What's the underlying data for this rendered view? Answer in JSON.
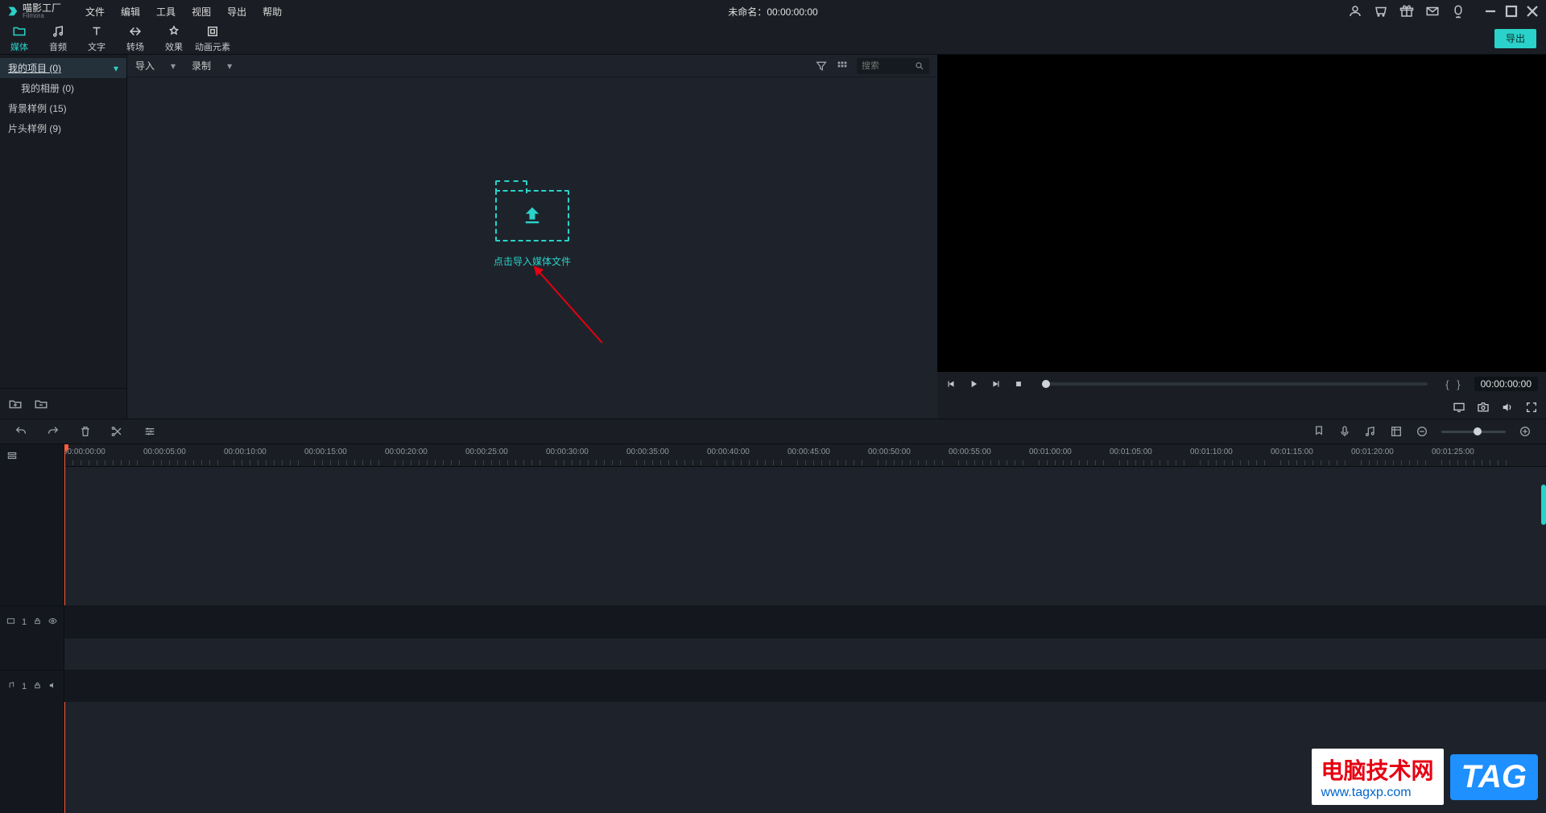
{
  "app": {
    "name": "喵影工厂",
    "subtitle": "Filmora"
  },
  "menu": [
    "文件",
    "编辑",
    "工具",
    "视图",
    "导出",
    "帮助"
  ],
  "title": {
    "name": "未命名",
    "time": "00:00:00:00"
  },
  "titlebar_icons": [
    "user",
    "cart",
    "gift",
    "mail",
    "mic"
  ],
  "window_controls": [
    "minimize",
    "maximize",
    "close"
  ],
  "tabs": [
    {
      "id": "media",
      "label": "媒体"
    },
    {
      "id": "audio",
      "label": "音频"
    },
    {
      "id": "text",
      "label": "文字"
    },
    {
      "id": "trans",
      "label": "转场"
    },
    {
      "id": "effect",
      "label": "效果"
    },
    {
      "id": "anim",
      "label": "动画元素"
    }
  ],
  "export_label": "导出",
  "sidebar": {
    "items": [
      {
        "label": "我的项目 (0)",
        "selected": true,
        "expandable": true
      },
      {
        "label": "我的相册 (0)",
        "child": true
      },
      {
        "label": "背景样例 (15)"
      },
      {
        "label": "片头样例 (9)"
      }
    ]
  },
  "center_bar": {
    "import_label": "导入",
    "record_label": "录制",
    "search_placeholder": "搜索"
  },
  "drop_label": "点击导入媒体文件",
  "preview": {
    "time": "00:00:00:00"
  },
  "ruler": [
    "00:00:00:00",
    "00:00:05:00",
    "00:00:10:00",
    "00:00:15:00",
    "00:00:20:00",
    "00:00:25:00",
    "00:00:30:00",
    "00:00:35:00",
    "00:00:40:00",
    "00:00:45:00",
    "00:00:50:00",
    "00:00:55:00",
    "00:01:00:00",
    "00:01:05:00",
    "00:01:10:00",
    "00:01:15:00",
    "00:01:20:00",
    "00:01:25:00"
  ],
  "tracks": {
    "video_label": "1",
    "audio_label": "1"
  },
  "watermark": {
    "line1": "电脑技术网",
    "line2": "www.tagxp.com",
    "tag": "TAG"
  }
}
